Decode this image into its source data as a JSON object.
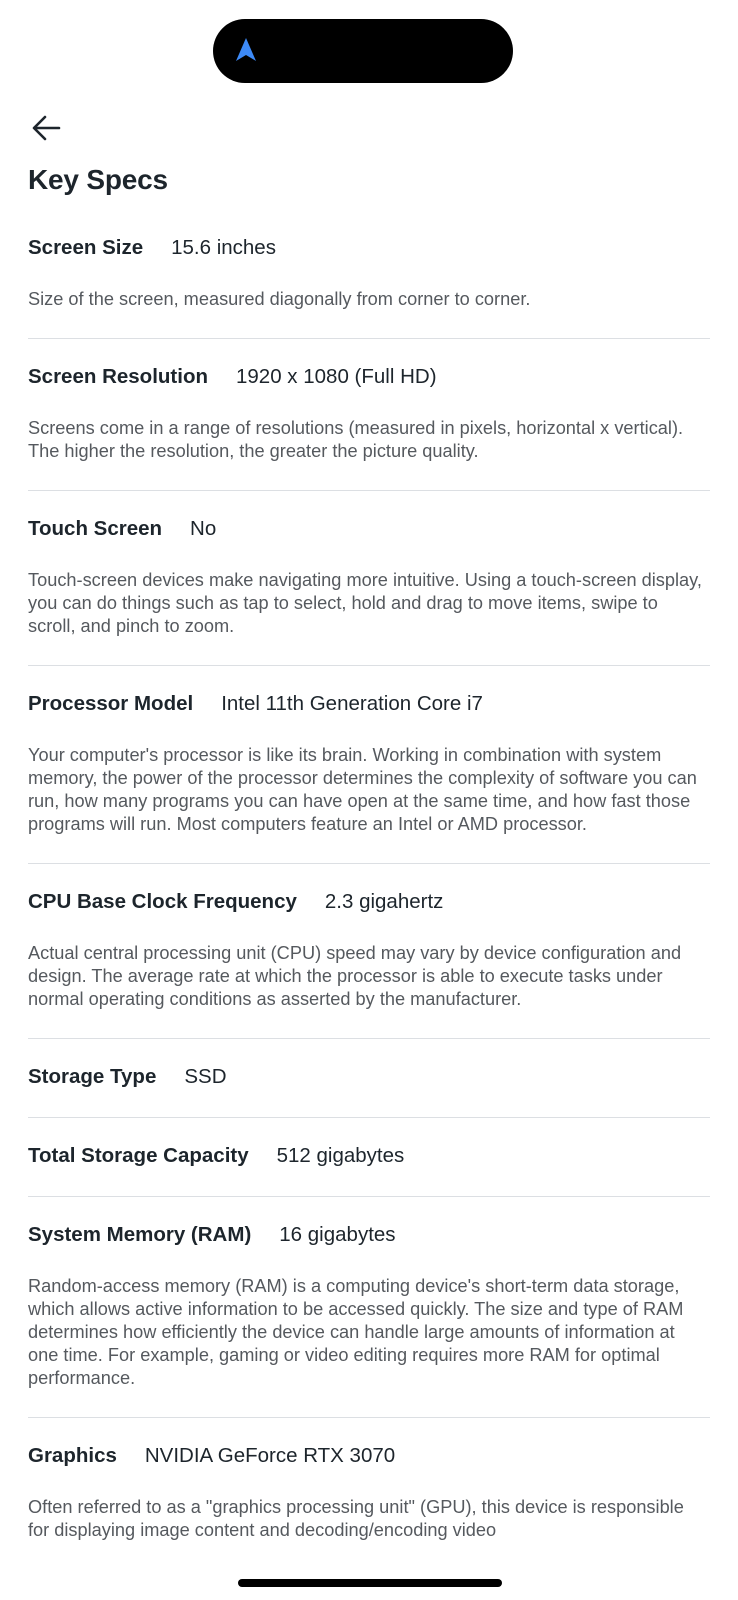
{
  "colors": {
    "text": "#1d252c",
    "description": "#55595e",
    "divider": "#dcdfe3",
    "nav_accent": "#3d8af7"
  },
  "icons": {
    "status": "navigation-arrow-icon",
    "back": "arrow-left-icon"
  },
  "page": {
    "title": "Key Specs"
  },
  "specs": [
    {
      "label": "Screen Size",
      "value": "15.6 inches",
      "description": "Size of the screen, measured diagonally from corner to corner."
    },
    {
      "label": "Screen Resolution",
      "value": "1920 x 1080 (Full HD)",
      "description": "Screens come in a range of resolutions (measured in pixels, horizontal x vertical). The higher the resolution, the greater the picture quality."
    },
    {
      "label": "Touch Screen",
      "value": "No",
      "description": "Touch-screen devices make navigating more intuitive. Using a touch-screen display, you can do things such as tap to select, hold and drag to move items, swipe to scroll, and pinch to zoom."
    },
    {
      "label": "Processor Model",
      "value": "Intel 11th Generation Core i7",
      "description": "Your computer's processor is like its brain. Working in combination with system memory, the power of the processor determines the complexity of software you can run, how many programs you can have open at the same time, and how fast those programs will run. Most computers feature an Intel or AMD processor."
    },
    {
      "label": "CPU Base Clock Frequency",
      "value": "2.3 gigahertz",
      "description": "Actual central processing unit (CPU) speed may vary by device configuration and design. The average rate at which the processor is able to execute tasks under normal operating conditions as asserted by the manufacturer."
    },
    {
      "label": "Storage Type",
      "value": "SSD",
      "description": ""
    },
    {
      "label": "Total Storage Capacity",
      "value": "512 gigabytes",
      "description": ""
    },
    {
      "label": "System Memory (RAM)",
      "value": "16 gigabytes",
      "description": "Random-access memory (RAM) is a computing device's short-term data storage, which allows active information to be accessed quickly. The size and type of RAM determines how efficiently the device can handle large amounts of information at one time. For example, gaming or video editing requires more RAM for optimal performance."
    },
    {
      "label": "Graphics",
      "value": "NVIDIA GeForce RTX 3070",
      "description": "Often referred to as a \"graphics processing unit\" (GPU), this device is responsible for displaying image content and decoding/encoding video"
    }
  ]
}
